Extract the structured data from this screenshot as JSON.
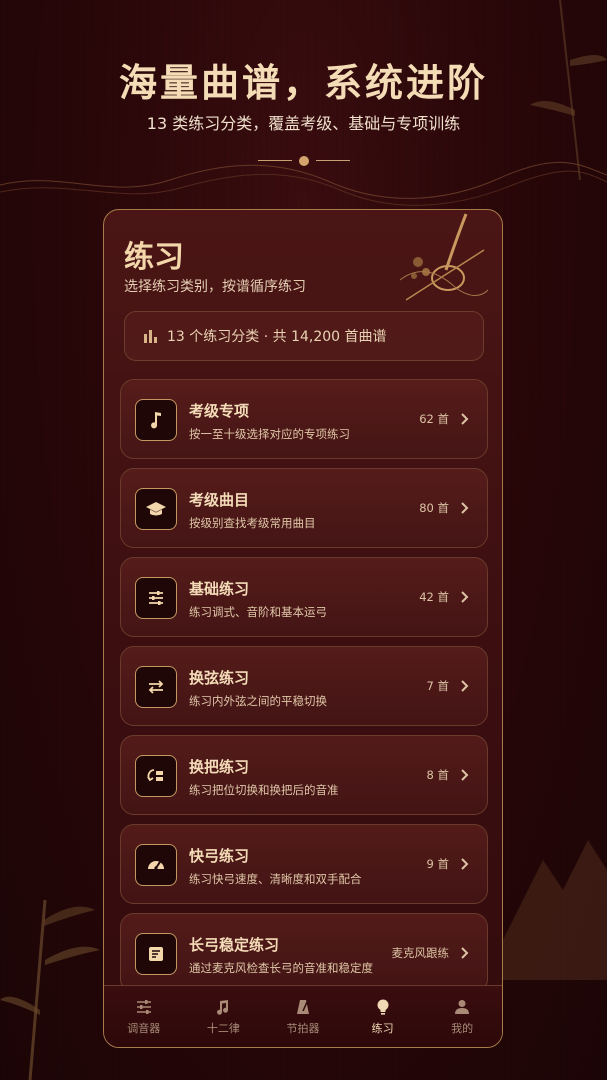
{
  "hero": {
    "title": "海量曲谱，系统进阶",
    "subtitle": "13 类练习分类，覆盖考级、基础与专项训练"
  },
  "page": {
    "title": "练习",
    "subtitle": "选择练习类别，按谱循序练习"
  },
  "summary": {
    "text": "13 个练习分类 · 共 14,200 首曲谱",
    "icon": "bar-chart-icon"
  },
  "items": [
    {
      "title": "考级专项",
      "desc": "按一至十级选择对应的专项练习",
      "count": "62 首",
      "icon": "music-note-icon"
    },
    {
      "title": "考级曲目",
      "desc": "按级别查找考级常用曲目",
      "count": "80 首",
      "icon": "graduation-cap-icon"
    },
    {
      "title": "基础练习",
      "desc": "练习调式、音阶和基本运弓",
      "count": "42 首",
      "icon": "sliders-icon"
    },
    {
      "title": "换弦练习",
      "desc": "练习内外弦之间的平稳切换",
      "count": "7 首",
      "icon": "swap-arrows-icon"
    },
    {
      "title": "换把练习",
      "desc": "练习把位切换和换把后的音准",
      "count": "8 首",
      "icon": "position-shift-icon"
    },
    {
      "title": "快弓练习",
      "desc": "练习快弓速度、清晰度和双手配合",
      "count": "9 首",
      "icon": "speedometer-icon"
    },
    {
      "title": "长弓稳定练习",
      "desc": "通过麦克风检查长弓的音准和稳定度",
      "count": "麦克风跟练",
      "icon": "document-icon"
    }
  ],
  "tabs": [
    {
      "label": "调音器",
      "icon": "tuner-sliders-icon",
      "active": false
    },
    {
      "label": "十二律",
      "icon": "music-note-icon",
      "active": false
    },
    {
      "label": "节拍器",
      "icon": "metronome-icon",
      "active": false
    },
    {
      "label": "练习",
      "icon": "lightbulb-icon",
      "active": true
    },
    {
      "label": "我的",
      "icon": "user-icon",
      "active": false
    }
  ],
  "colors": {
    "background": "#2a0709",
    "accent_gold": "#d3a46c",
    "card_border": "#a77c4a",
    "text_primary": "#f4dcb8"
  }
}
